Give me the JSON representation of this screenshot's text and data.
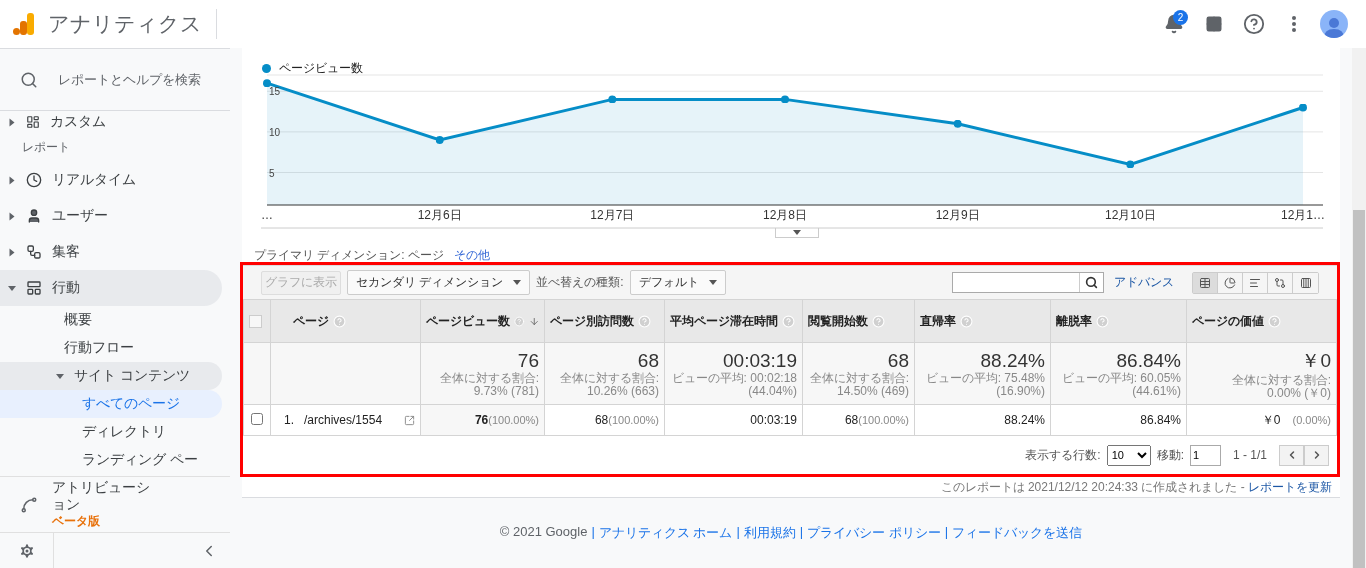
{
  "header": {
    "app_name": "アナリティクス",
    "notification_count": "2"
  },
  "sidebar": {
    "search_placeholder": "レポートとヘルプを検索",
    "top_item": "カスタム",
    "section_label": "レポート",
    "items": [
      {
        "label": "リアルタイム",
        "kind": "clock",
        "expanded": false
      },
      {
        "label": "ユーザー",
        "kind": "person",
        "expanded": false
      },
      {
        "label": "集客",
        "kind": "flow",
        "expanded": false
      },
      {
        "label": "行動",
        "kind": "screen",
        "expanded": true,
        "children": [
          {
            "label": "概要",
            "selected": false
          },
          {
            "label": "行動フロー",
            "selected": false
          },
          {
            "label": "サイト コンテンツ",
            "selected": false,
            "expanded": true,
            "children": [
              {
                "label": "すべてのページ",
                "selected": true
              },
              {
                "label": "ディレクトリ",
                "selected": false
              },
              {
                "label": "ランディング ペー",
                "selected": false
              }
            ]
          }
        ]
      }
    ],
    "attribution": {
      "label": "アトリビューション",
      "badge": "ベータ版"
    }
  },
  "chart": {
    "chart_data": {
      "type": "area",
      "categories": [
        "…",
        "12月6日",
        "12月7日",
        "12月8日",
        "12月9日",
        "12月10日",
        "12月1…"
      ],
      "series": [
        {
          "name": "ページビュー数",
          "color": "#058dc7",
          "values": [
            16,
            9,
            14,
            14,
            11,
            6,
            13
          ]
        }
      ],
      "ylim": [
        1,
        17
      ],
      "yticks": [
        5,
        10,
        15
      ],
      "grid": true
    }
  },
  "dimension_bar": {
    "label": "プライマリ ディメンション: ページ",
    "more": "その他"
  },
  "toolbar": {
    "graph_button": {
      "label": "グラフに表示",
      "disabled": true
    },
    "secondary_dimension": "セカンダリ ディメンション",
    "sort_label": "並べ替えの種類:",
    "sort_value": "デフォルト",
    "advanced": "アドバンス",
    "views": [
      {
        "kind": "table",
        "selected": true
      },
      {
        "kind": "pie",
        "selected": false
      },
      {
        "kind": "bars",
        "selected": false
      },
      {
        "kind": "compare",
        "selected": false
      },
      {
        "kind": "pivot",
        "selected": false
      }
    ]
  },
  "table": {
    "header_checked": false,
    "columns": [
      {
        "label": "ページ",
        "sorted": false
      },
      {
        "label": "ページビュー数",
        "sorted": true
      },
      {
        "label": "ページ別訪問数",
        "sorted": false
      },
      {
        "label": "平均ページ滞在時間",
        "sorted": false
      },
      {
        "label": "閲覧開始数",
        "sorted": false
      },
      {
        "label": "直帰率",
        "sorted": false
      },
      {
        "label": "離脱率",
        "sorted": false
      },
      {
        "label": "ページの価値",
        "sorted": false
      }
    ],
    "totals": [
      {
        "value": "76",
        "note": "全体に対する割合:",
        "detail": "9.73% (781)"
      },
      {
        "value": "68",
        "note": "全体に対する割合:",
        "detail": "10.26% (663)"
      },
      {
        "value": "00:03:19",
        "note": "ビューの平均: 00:02:18",
        "detail": "(44.04%)"
      },
      {
        "value": "68",
        "note": "全体に対する割合:",
        "detail": "14.50% (469)"
      },
      {
        "value": "88.24%",
        "note": "ビューの平均: 75.48%",
        "detail": "(16.90%)"
      },
      {
        "value": "86.84%",
        "note": "ビューの平均: 60.05%",
        "detail": "(44.61%)"
      },
      {
        "value": "￥0",
        "note": "全体に対する割合:",
        "detail": "0.00% (￥0)"
      }
    ],
    "rows": [
      {
        "index": "1.",
        "checked": false,
        "cells": [
          {
            "value": "/archives/1554",
            "bold": false
          },
          {
            "value": "76",
            "share": "(100.00%)",
            "bold": true
          },
          {
            "value": "68",
            "share": "(100.00%)",
            "bold": false
          },
          {
            "value": "00:03:19",
            "bold": false
          },
          {
            "value": "68",
            "share": "(100.00%)",
            "bold": false
          },
          {
            "value": "88.24%",
            "bold": false
          },
          {
            "value": "86.84%",
            "bold": false
          },
          {
            "value": "￥0",
            "share": "(0.00%)",
            "bold": false
          }
        ]
      }
    ]
  },
  "pagination": {
    "rows_label": "表示する行数:",
    "rows_value": "10",
    "goto_label": "移動:",
    "goto_value": "1",
    "range": "1 - 1/1"
  },
  "report_note": {
    "text": "このレポートは 2021/12/12 20:24:33 に作成されました - ",
    "link": "レポートを更新"
  },
  "footer": [
    {
      "kind": "text",
      "text": "© 2021 Google"
    },
    {
      "kind": "sep",
      "text": "|"
    },
    {
      "kind": "link",
      "text": "アナリティクス ホーム"
    },
    {
      "kind": "sep",
      "text": "|"
    },
    {
      "kind": "link",
      "text": "利用規約"
    },
    {
      "kind": "sep",
      "text": "|"
    },
    {
      "kind": "link",
      "text": "プライバシー ポリシー"
    },
    {
      "kind": "sep",
      "text": "|"
    },
    {
      "kind": "link",
      "text": "フィードバックを送信"
    }
  ]
}
